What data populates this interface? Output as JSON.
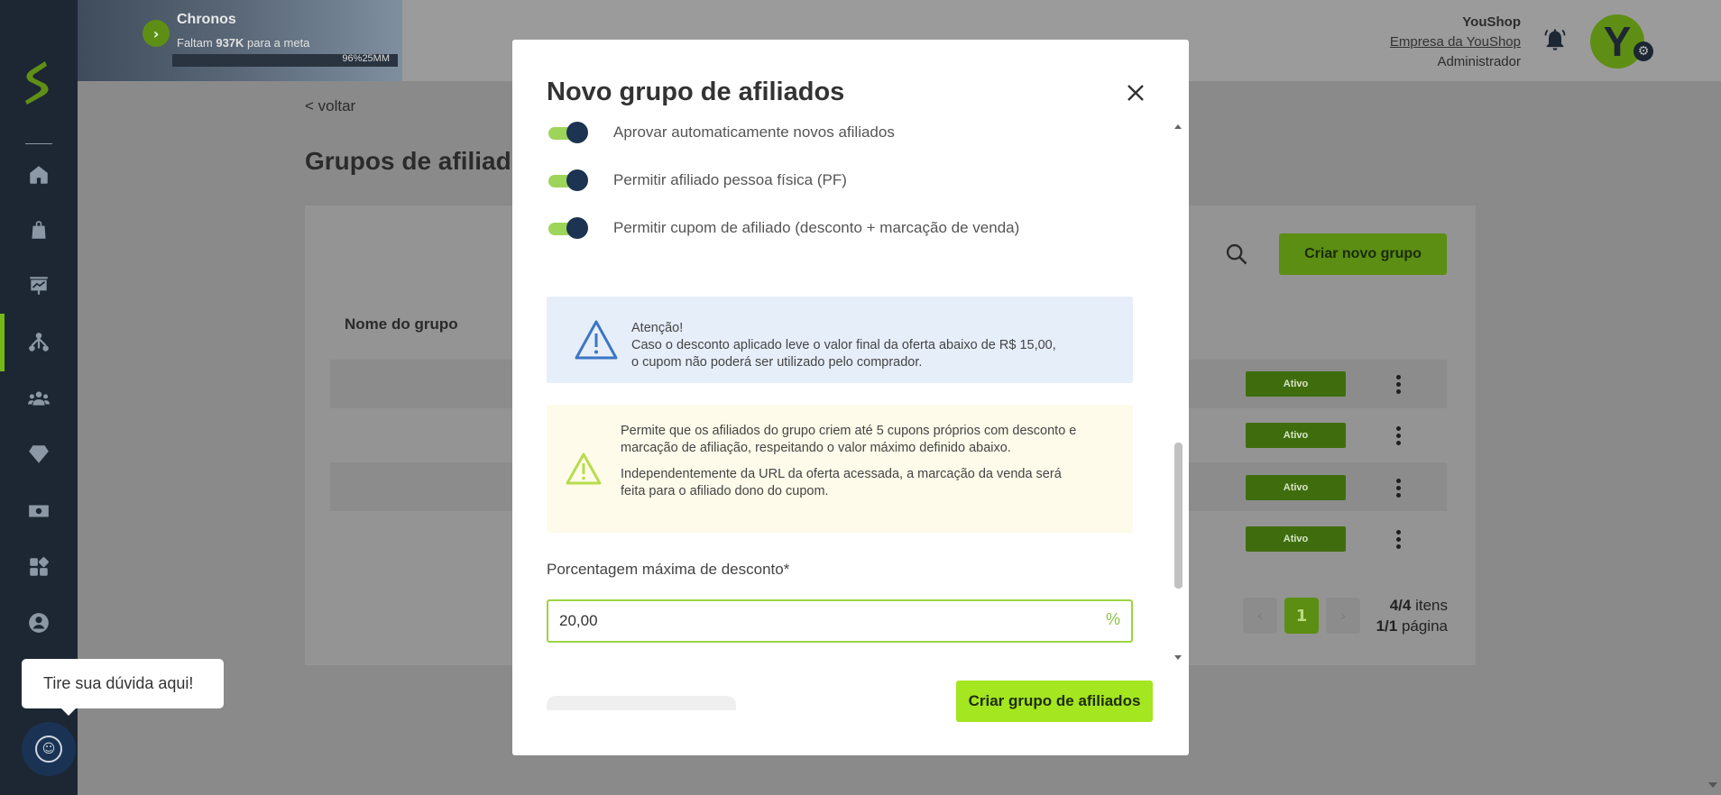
{
  "banner": {
    "title": "Chronos",
    "subtitle_prefix": "Faltam ",
    "subtitle_amount": "937K",
    "subtitle_suffix": " para a meta",
    "progress_text": "96%25MM",
    "progress_fraction": 0.96
  },
  "user": {
    "name": "YouShop",
    "company": "Empresa da YouShop",
    "role": "Administrador",
    "avatar_letter": "Y"
  },
  "page": {
    "back_label": "< voltar",
    "title": "Grupos de afiliados",
    "new_group_button": "Criar novo grupo",
    "column_name": "Nome do grupo",
    "rows": [
      {
        "status": "Ativo"
      },
      {
        "status": "Ativo"
      },
      {
        "status": "Ativo"
      },
      {
        "status": "Ativo"
      }
    ],
    "pager": {
      "current_page": "1",
      "items_count": "4/4",
      "items_label": " itens",
      "pages_count": "1/1",
      "pages_label": " página"
    }
  },
  "help": {
    "bubble_text": "Tire sua dúvida aqui!"
  },
  "modal": {
    "title": "Novo grupo de afiliados",
    "toggles": [
      {
        "label": "Aprovar automaticamente novos afiliados",
        "on": true
      },
      {
        "label": "Permitir afiliado pessoa física (PF)",
        "on": true
      },
      {
        "label": "Permitir cupom de afiliado (desconto + marcação de venda)",
        "on": true
      }
    ],
    "alert_blue": {
      "line1": "Atenção!",
      "line2": "Caso o desconto aplicado leve o valor final da oferta abaixo de R$ 15,00,",
      "line3": "o cupom não poderá ser utilizado pelo comprador."
    },
    "alert_yellow": {
      "para1": "Permite que os afiliados do grupo criem até 5 cupons próprios com desconto e marcação de afiliação, respeitando o valor máximo definido abaixo.",
      "para2": "Independentemente da URL da oferta acessada, a marcação da venda será feita para o afiliado dono do cupom."
    },
    "discount_field": {
      "label": "Porcentagem máxima de desconto*",
      "value": "20,00",
      "unit": "%"
    },
    "submit_button": "Criar grupo de afiliados"
  },
  "colors": {
    "sidebar": "#1c2733",
    "accent_green": "#a4e61f",
    "toggle_knob": "#1c3352",
    "info_bg": "#e6eefa",
    "warning_bg": "#fefbea"
  }
}
